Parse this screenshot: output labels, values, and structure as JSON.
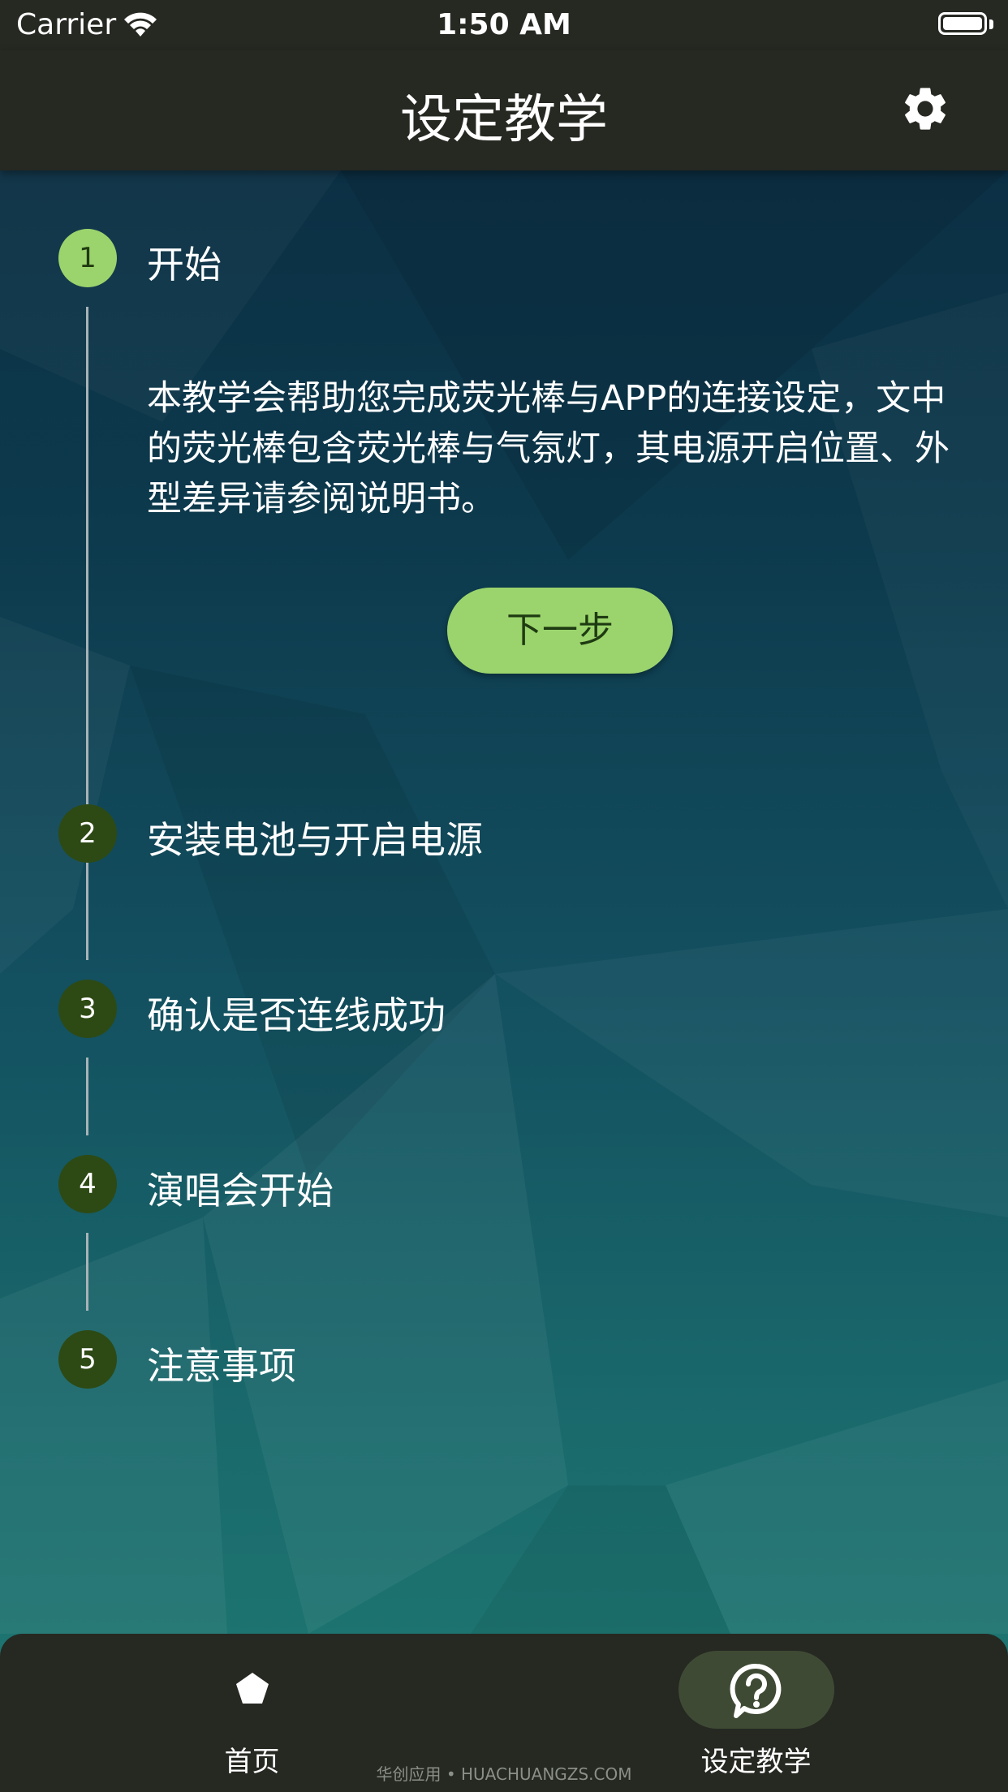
{
  "status_bar": {
    "carrier": "Carrier",
    "time": "1:50 AM"
  },
  "header": {
    "title": "设定教学",
    "settings_icon": "gear-icon"
  },
  "steps": [
    {
      "number": "1",
      "title": "开始",
      "state": "active"
    },
    {
      "number": "2",
      "title": "安装电池与开启电源",
      "state": "inactive"
    },
    {
      "number": "3",
      "title": "确认是否连线成功",
      "state": "inactive"
    },
    {
      "number": "4",
      "title": "演唱会开始",
      "state": "inactive"
    },
    {
      "number": "5",
      "title": "注意事项",
      "state": "inactive"
    }
  ],
  "active_step": {
    "description": "本教学会帮助您完成荧光棒与APP的连接设定，文中的荧光棒包含荧光棒与气氛灯，其电源开启位置、外型差异请参阅说明书。",
    "next_label": "下一步"
  },
  "tab_bar": {
    "tabs": [
      {
        "label": "首页",
        "icon": "pentagon-icon",
        "selected": false
      },
      {
        "label": "设定教学",
        "icon": "help-bubble-icon",
        "selected": true
      }
    ]
  },
  "watermark": "华创应用 • HUACHUANGZS.COM",
  "colors": {
    "accent": "#9bd46c",
    "bar": "#262822",
    "inactive_step": "#2d4a14"
  }
}
